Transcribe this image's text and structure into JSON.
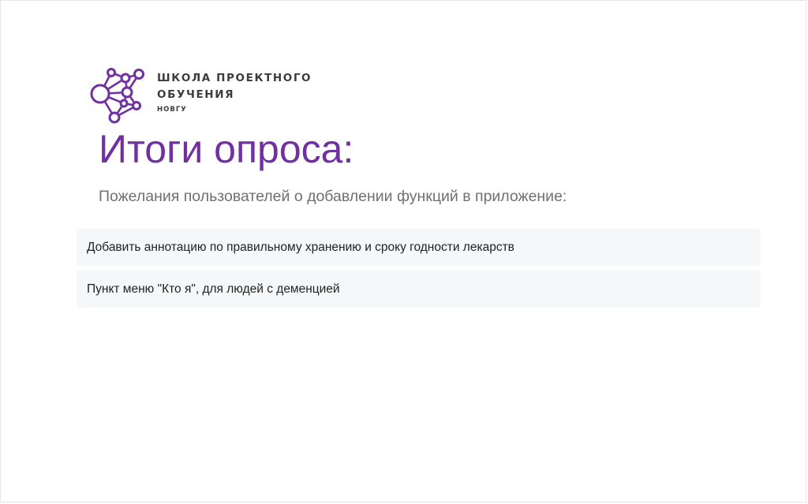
{
  "logo": {
    "line1": "ШКОЛА ПРОЕКТНОГО",
    "line2": "ОБУЧЕНИЯ",
    "line3": "НОВГУ",
    "color": "#7030a0",
    "icon": "molecule-network-icon"
  },
  "title": "Итоги опроса:",
  "subtitle": "Пожелания пользователей о добавлении функций в приложение:",
  "answers": [
    "Добавить аннотацию по правильному хранению и сроку годности лекарств",
    "Пункт меню \"Кто я\", для людей с деменцией"
  ],
  "colors": {
    "title": "#7030a0",
    "subtitle": "#707070",
    "answer_bg": "#f6f7f9"
  }
}
